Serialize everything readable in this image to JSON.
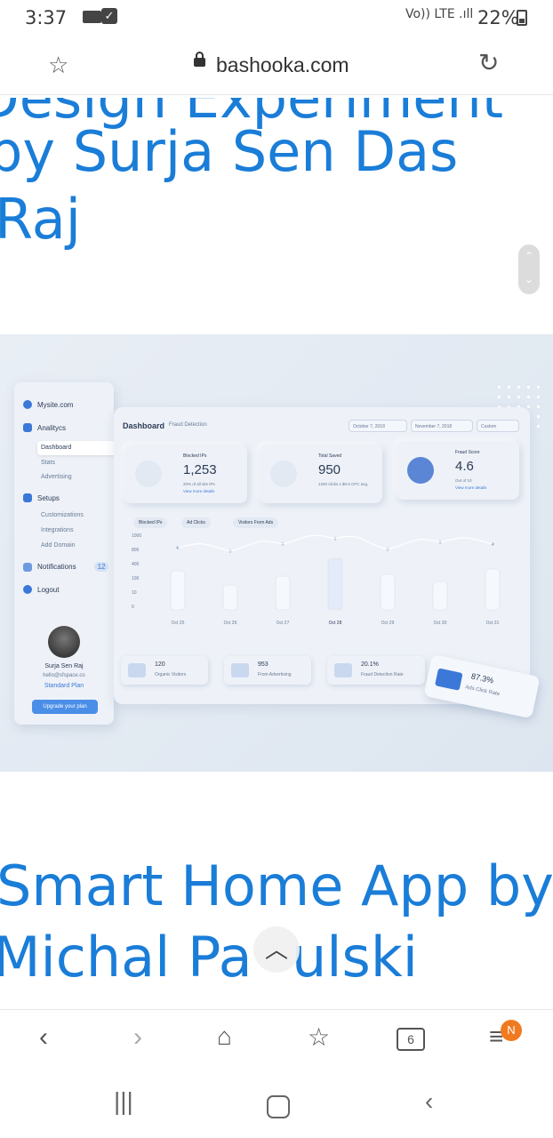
{
  "status_bar": {
    "time": "3:37",
    "network": "Vo)) LTE .ıll",
    "battery": "22%"
  },
  "browser": {
    "url": "bashooka.com"
  },
  "article1": {
    "title_lines": [
      "Design Experiment",
      "by Surja Sen Das",
      "Raj"
    ]
  },
  "dashboard_image": {
    "sidebar": {
      "site": "Mysite.com",
      "sections": [
        "Analitycs",
        "Setups",
        "Notifications",
        "Logout"
      ],
      "analytics_items": [
        "Dashboard",
        "Stats",
        "Advertising"
      ],
      "setup_items": [
        "Customizations",
        "Integrations",
        "Add Domain"
      ],
      "notifications_count": "12",
      "user_name": "Surja Sen Raj",
      "user_email": "hello@sfspace.co",
      "plan": "Standard Plan",
      "upgrade": "Upgrade your plan"
    },
    "header": {
      "title": "Dashboard",
      "subtitle": "Fraud Detection",
      "date_from": "October 7, 2018",
      "date_to": "November 7, 2018",
      "range": "Custom"
    },
    "cards": [
      {
        "label": "Blocked IPs",
        "value": "1,253",
        "note": "20% of all site IPs",
        "link": "View more details"
      },
      {
        "label": "Total Saved",
        "value": "950",
        "note": "1200 clicks x $0.5 CPC avg.",
        "link": ""
      },
      {
        "label": "Fraud Score",
        "value": "4.6",
        "note": "Out of 10",
        "link": "View more details"
      }
    ],
    "chart_chips": [
      "Blocked IPs",
      "Ad Clicks",
      "Visitors From Ads"
    ],
    "chart_y_ticks": [
      "1000",
      "800",
      "400",
      "100",
      "10",
      "0"
    ],
    "chart_x_ticks": [
      "Oct 25",
      "Oct 26",
      "Oct 27",
      "Oct 28",
      "Oct 29",
      "Oct 30",
      "Oct 31"
    ],
    "bottom_stats": [
      {
        "value": "120",
        "label": "Organic Visitors"
      },
      {
        "value": "953",
        "label": "From Advertising"
      },
      {
        "value": "20.1%",
        "label": "Fraud Detection Rate"
      }
    ],
    "tilted_card": {
      "value": "87.3%",
      "label": "Ads Click Rate"
    }
  },
  "article2": {
    "title_lines": [
      "Smart Home App by",
      "Michal Pa",
      "ulski"
    ]
  },
  "bottom_nav": {
    "tabs_count": "6",
    "badge": "N"
  },
  "icons": [
    "star-icon",
    "lock-icon",
    "reload-icon",
    "back-icon",
    "forward-icon",
    "home-icon",
    "favorites-icon",
    "tabs-icon",
    "menu-icon",
    "scroll-top-icon"
  ]
}
